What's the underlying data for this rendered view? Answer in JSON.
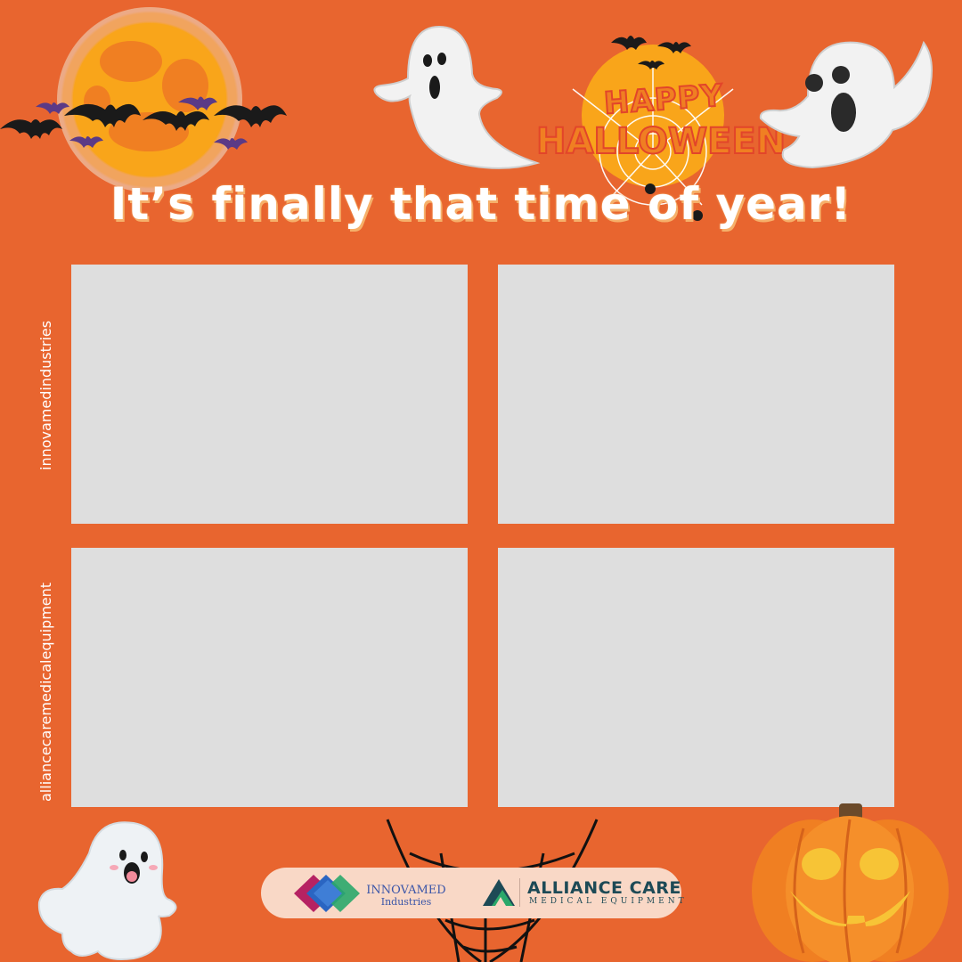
{
  "headline": "It’s finally that time of year!",
  "happy_text": "HAPPY",
  "halloween_text": "HALLOWEEN",
  "side_labels": {
    "top": "innovamedindustries",
    "bottom": "alliancecaremedicalequipment"
  },
  "logos": {
    "innovamed_name": "INNOVAMED",
    "innovamed_sub": "Industries",
    "alliance_name": "ALLIANCE CARE",
    "alliance_sub": "MEDICAL EQUIPMENT"
  },
  "colors": {
    "background": "#e8652f",
    "panel": "#dedede",
    "moon": "#f9a51a",
    "logo_bar": "#f9d8c6"
  },
  "icons": [
    "full-moon-icon",
    "bat-icon",
    "ghost-icon",
    "spiderweb-icon",
    "spider-icon",
    "jack-o-lantern-icon",
    "skull-icon"
  ]
}
